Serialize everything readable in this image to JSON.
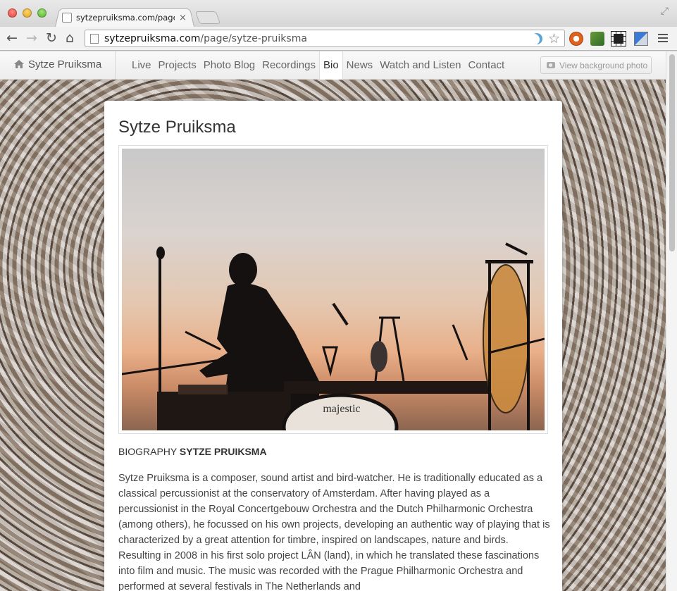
{
  "browser": {
    "tab_title": "sytzepruiksma.com/page/",
    "url_domain": "sytzepruiksma.com",
    "url_path": "/page/sytze-pruiksma"
  },
  "site": {
    "brand": "Sytze Pruiksma",
    "nav": [
      "Live",
      "Projects",
      "Photo Blog",
      "Recordings",
      "Bio",
      "News",
      "Watch and Listen",
      "Contact"
    ],
    "active_nav": "Bio",
    "bg_photo_button": "View background photo"
  },
  "content": {
    "title": "Sytze Pruiksma",
    "bio_label": "BIOGRAPHY",
    "bio_name": "SYTZE PRUIKSMA",
    "bio_text": "Sytze Pruiksma is a composer, sound artist and bird-watcher. He is traditionally educated as a classical percussionist at the conservatory of Amsterdam. After having played as a percussionist in the Royal Concertgebouw Orchestra and the Dutch Philharmonic Orchestra (among others), he focussed on his own projects, developing an authentic way of playing that is characterized by a great attention for timbre, inspired on landscapes, nature and birds. Resulting in 2008 in his first solo project LÂN (land), in which he translated these fascinations into film and music. The music was recorded with the Prague Philharmonic Orchestra and performed at several festivals in The Netherlands and",
    "drum_brand": "majestic"
  }
}
